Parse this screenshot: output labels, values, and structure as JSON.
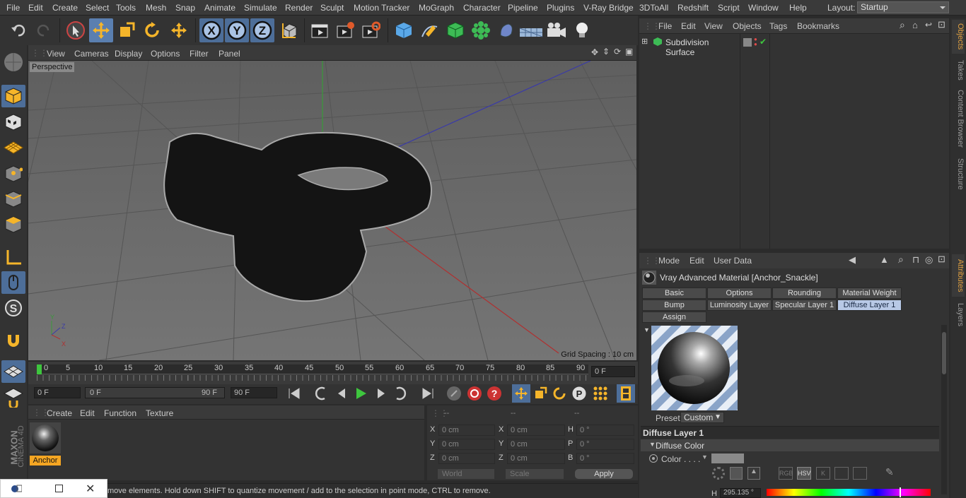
{
  "menu": {
    "items": [
      "File",
      "Edit",
      "Create",
      "Select",
      "Tools",
      "Mesh",
      "Snap",
      "Animate",
      "Simulate",
      "Render",
      "Sculpt",
      "Motion Tracker",
      "MoGraph",
      "Character",
      "Pipeline",
      "Plugins",
      "V-Ray Bridge",
      "3DToAll",
      "Redshift",
      "Script",
      "Window",
      "Help"
    ],
    "layout_label": "Layout:",
    "layout_value": "Startup"
  },
  "viewport": {
    "menu": [
      "View",
      "Cameras",
      "Display",
      "Options",
      "Filter",
      "Panel"
    ],
    "label": "Perspective",
    "grid_spacing": "Grid Spacing : 10 cm"
  },
  "timeline": {
    "ticks": [
      "0",
      "5",
      "10",
      "15",
      "20",
      "25",
      "30",
      "35",
      "40",
      "45",
      "50",
      "55",
      "60",
      "65",
      "70",
      "75",
      "80",
      "85",
      "90"
    ],
    "current_frame": "0 F",
    "start": "0 F",
    "range_start": "0 F",
    "range_end": "90 F",
    "end": "90 F",
    "right_field": "0 F"
  },
  "material_manager": {
    "menu": [
      "Create",
      "Edit",
      "Function",
      "Texture"
    ],
    "material_name": "Anchor"
  },
  "coords": {
    "headers": [
      "--",
      "--",
      "--"
    ],
    "rows": [
      {
        "a": "X",
        "av": "0 cm",
        "b": "X",
        "bv": "0 cm",
        "c": "H",
        "cv": "0 °"
      },
      {
        "a": "Y",
        "av": "0 cm",
        "b": "Y",
        "bv": "0 cm",
        "c": "P",
        "cv": "0 °"
      },
      {
        "a": "Z",
        "av": "0 cm",
        "b": "Z",
        "bv": "0 cm",
        "c": "B",
        "cv": "0 °"
      }
    ],
    "world": "World",
    "scale": "Scale",
    "apply": "Apply"
  },
  "status": {
    "text": "move elements. Hold down SHIFT to quantize movement / add to the selection in point mode, CTRL to remove."
  },
  "objects": {
    "menu": [
      "File",
      "Edit",
      "View",
      "Objects",
      "Tags",
      "Bookmarks"
    ],
    "items": [
      "Subdivision Surface"
    ]
  },
  "attributes": {
    "menu": [
      "Mode",
      "Edit",
      "User Data"
    ],
    "title": "Vray Advanced Material [Anchor_Snackle]",
    "tabs": [
      "Basic",
      "Options",
      "Rounding",
      "Material Weight",
      "Bump",
      "Luminosity Layer",
      "Specular Layer 1",
      "Diffuse Layer 1",
      "Assign"
    ],
    "selected_tab": "Diffuse Layer 1",
    "preset_label": "Preset",
    "preset_value": "Custom",
    "section": "Diffuse Layer 1",
    "subsection": "Diffuse Color",
    "color_label": "Color . . . .",
    "color_modes": [
      "RGB",
      "HSV",
      "K"
    ],
    "h_label": "H",
    "h_value": "295.135 °"
  },
  "side_tabs": [
    "Objects",
    "Takes",
    "Content Browser",
    "Structure",
    "Attributes",
    "Layers"
  ],
  "brand": {
    "line1": "MAXON",
    "line2": "CINEMA 4D"
  },
  "colors": {
    "accent": "#5a7fb0",
    "selected_tab": "#b8c9e6",
    "orange": "#f5a623"
  }
}
